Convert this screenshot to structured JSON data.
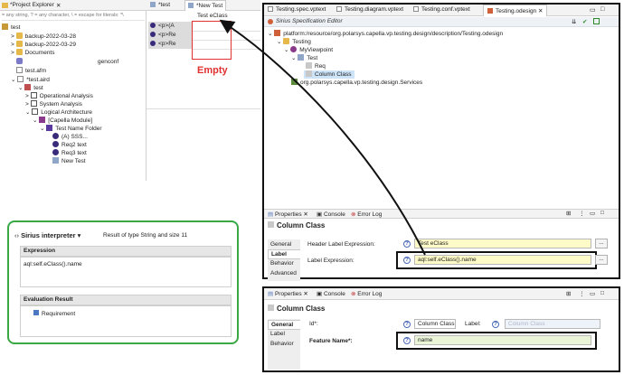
{
  "project_explorer": {
    "tab_label": "*Project Explorer",
    "filter_placeholder": "= any string, ? = any character, \\ = escape for literals: *\\",
    "tree": [
      "test",
      "backup-2022-03-28",
      "backup-2022-03-29",
      "Documents",
      "genconf",
      "test.afm",
      "*test.aird",
      "test",
      "Operational Analysis",
      "System Analysis",
      "Logical Architecture",
      "[Capella Module]",
      "Test Name Folder",
      "(A) SSS...",
      "Req2 text",
      "Req3 text",
      "New Test"
    ]
  },
  "middle_tabs": {
    "tab1": "*test",
    "tab2": "*New Test"
  },
  "table": {
    "rows": [
      "<p>(A",
      "<p>Re",
      "<p>Re"
    ],
    "column_header": "Test eClass"
  },
  "empty_annotation": "Empty",
  "spec_editor": {
    "tabs": [
      "Testing.spec.vptext",
      "Testing.diagram.vptext",
      "Testing.conf.vptext",
      "Testing.odesign"
    ],
    "title": "Sirius Specification Editor",
    "tree": [
      "platform:/resource/org.polarsys.capella.vp.testing.design/description/Testing.odesign",
      "Testing",
      "MyViewpoint",
      "Test",
      "Req",
      "Column Class",
      "org.polarsys.capella.vp.testing.design.Services"
    ]
  },
  "properties_top": {
    "tabs": [
      "Properties",
      "Console",
      "Error Log"
    ],
    "title": "Column Class",
    "side_tabs": [
      "General",
      "Label",
      "Behavior",
      "Advanced"
    ],
    "header_label": "Header Label Expression:",
    "header_value": "Test eClass",
    "label_label": "Label Expression:",
    "label_value": "aql:self.eClass().name",
    "browse": "..."
  },
  "properties_bottom": {
    "tabs": [
      "Properties",
      "Console",
      "Error Log"
    ],
    "title": "Column Class",
    "side_tabs": [
      "General",
      "Label",
      "Behavior"
    ],
    "id_label": "Id*:",
    "id_value": "Column Class",
    "label_label": "Label:",
    "label_placeholder": "Column Class",
    "feature_label": "Feature Name*:",
    "feature_value": "name"
  },
  "sirius": {
    "title": "Sirius interpreter",
    "result": "Result of type String and size 11",
    "expression_header": "Expression",
    "expression": "aql:self.eClass().name",
    "evaluation_header": "Evaluation Result",
    "result_item": "Requirement"
  },
  "colors": {
    "highlight_red": "#e03030",
    "green_frame": "#3aa845",
    "yellow_field": "#fffbc8",
    "green_field": "#eaf5d8"
  }
}
